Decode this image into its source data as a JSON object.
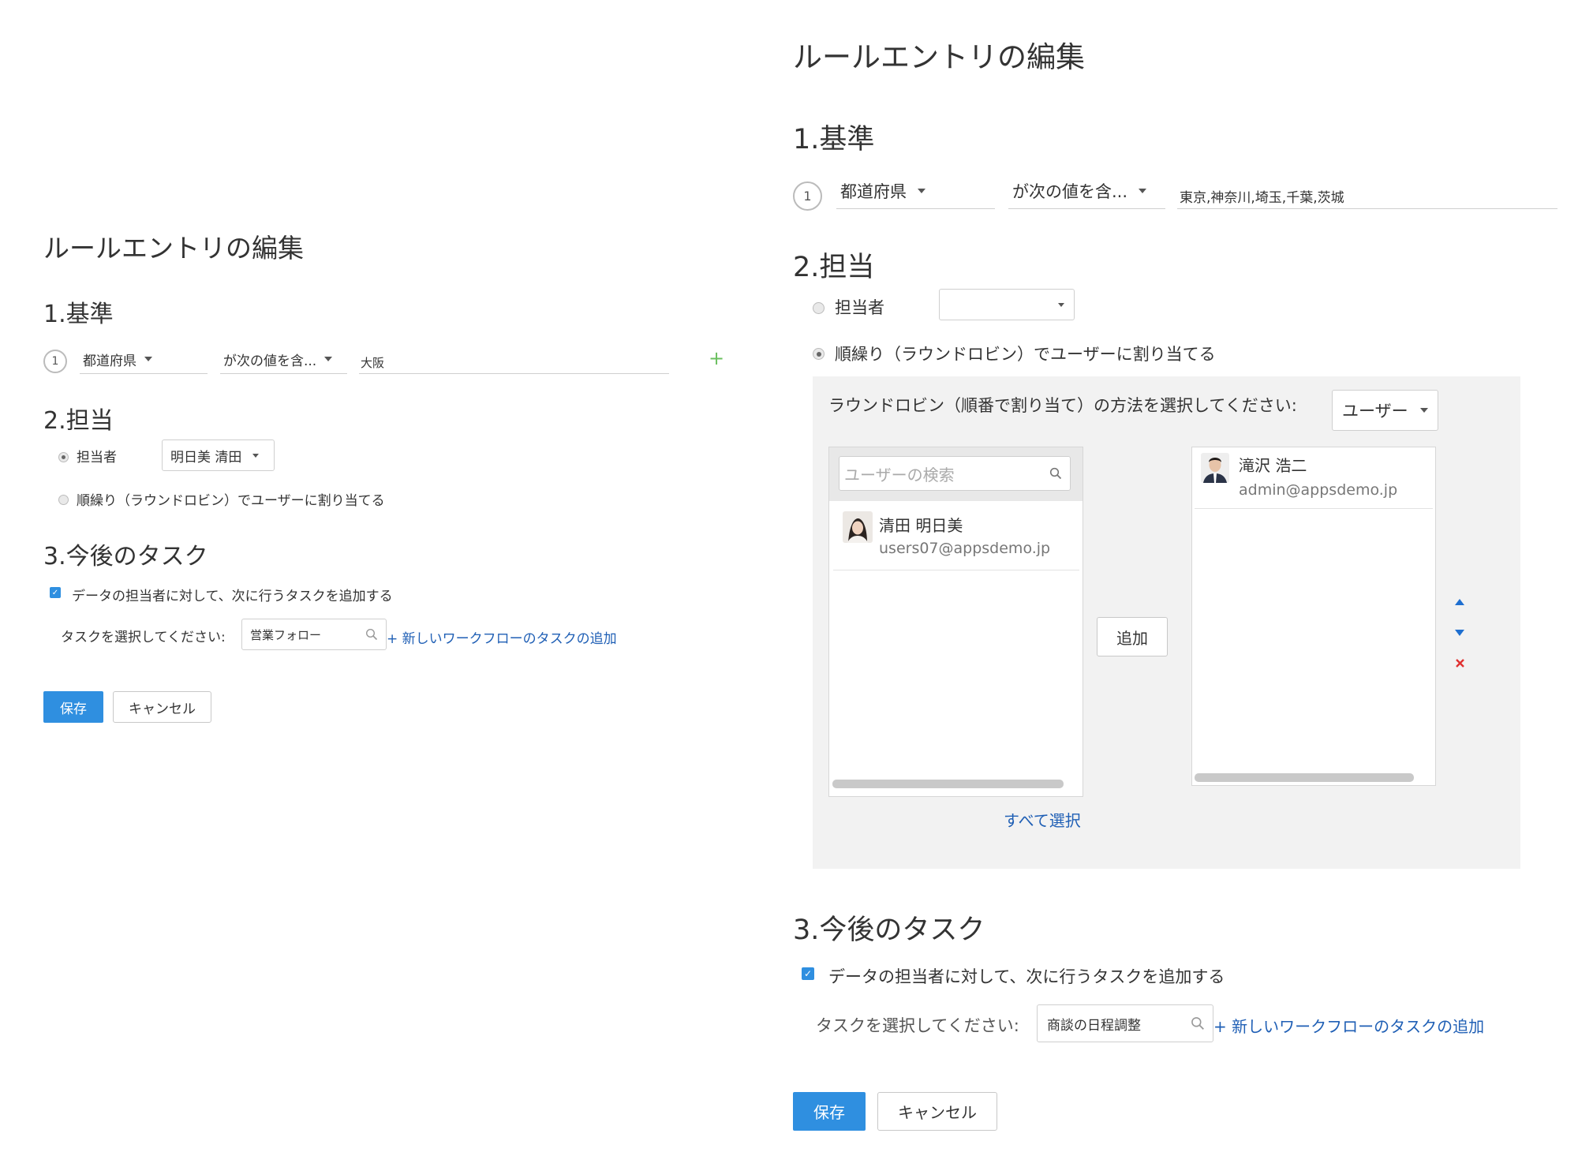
{
  "left": {
    "title": "ルールエントリの編集",
    "section1": {
      "heading": "1.基準",
      "row_number": "1",
      "field": "都道府県",
      "operator": "が次の値を含...",
      "value": "大阪",
      "add_icon": "plus-icon"
    },
    "section2": {
      "heading": "2.担当",
      "assignee_label": "担当者",
      "assignee_value": "明日美 清田",
      "roundrobin_label": "順繰り（ラウンドロビン）でユーザーに割り当てる"
    },
    "section3": {
      "heading": "3.今後のタスク",
      "checkbox_label": "データの担当者に対して、次に行うタスクを追加する",
      "task_prompt": "タスクを選択してください:",
      "task_value": "営業フォロー",
      "add_task_link": "+ 新しいワークフローのタスクの追加"
    },
    "save_label": "保存",
    "cancel_label": "キャンセル"
  },
  "right": {
    "title": "ルールエントリの編集",
    "section1": {
      "heading": "1.基準",
      "row_number": "1",
      "field": "都道府県",
      "operator": "が次の値を含...",
      "value": "東京,神奈川,埼玉,千葉,茨城"
    },
    "section2": {
      "heading": "2.担当",
      "assignee_label": "担当者",
      "assignee_value": "",
      "roundrobin_label": "順繰り（ラウンドロビン）でユーザーに割り当てる",
      "method_prompt": "ラウンドロビン（順番で割り当て）の方法を選択してください:",
      "method_value": "ユーザー",
      "search_placeholder": "ユーザーの検索",
      "available_users": [
        {
          "name": "清田 明日美",
          "email": "users07@appsdemo.jp"
        }
      ],
      "selected_users": [
        {
          "name": "滝沢 浩二",
          "email": "admin@appsdemo.jp"
        }
      ],
      "add_button": "追加",
      "select_all": "すべて選択"
    },
    "section3": {
      "heading": "3.今後のタスク",
      "checkbox_label": "データの担当者に対して、次に行うタスクを追加する",
      "task_prompt": "タスクを選択してください:",
      "task_value": "商談の日程調整",
      "add_task_link": "+ 新しいワークフローのタスクの追加"
    },
    "save_label": "保存",
    "cancel_label": "キャンセル"
  },
  "colors": {
    "primary": "#2f8fe0",
    "link": "#1f5fb5",
    "panel": "#f2f2f2",
    "remove": "#e03030",
    "plus": "#6abf5e"
  }
}
